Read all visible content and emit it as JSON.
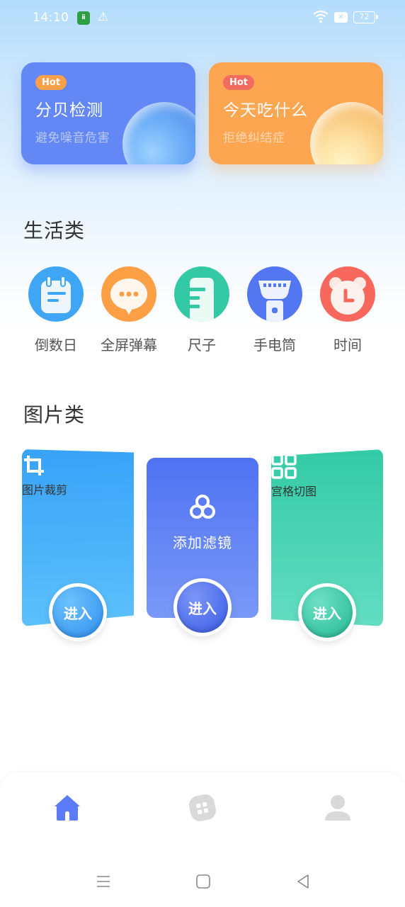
{
  "status_bar": {
    "time": "14:10",
    "battery": "72",
    "icons": [
      "app-notification-icon",
      "warning-icon",
      "wifi-icon",
      "sim-icon",
      "battery-icon"
    ]
  },
  "hot_cards": [
    {
      "badge": "Hot",
      "title": "分贝检测",
      "subtitle": "避免噪音危害",
      "color": "#6388f5"
    },
    {
      "badge": "Hot",
      "title": "今天吃什么",
      "subtitle": "拒绝纠结症",
      "color": "#fda651"
    }
  ],
  "sections": {
    "life": {
      "title": "生活类",
      "items": [
        {
          "label": "倒数日",
          "icon": "calendar-icon",
          "color": "#3ea6f4"
        },
        {
          "label": "全屏弹幕",
          "icon": "chat-bubble-icon",
          "color": "#fd9f45"
        },
        {
          "label": "尺子",
          "icon": "ruler-icon",
          "color": "#34c9a5"
        },
        {
          "label": "手电筒",
          "icon": "flashlight-icon",
          "color": "#5277f0"
        },
        {
          "label": "时间",
          "icon": "alarm-clock-icon",
          "color": "#f7675b"
        }
      ]
    },
    "image": {
      "title": "图片类",
      "items": [
        {
          "label": "图片裁剪",
          "icon": "crop-icon",
          "button": "进入",
          "color": "#42a8f8"
        },
        {
          "label": "添加滤镜",
          "icon": "filter-icon",
          "button": "进入",
          "color": "#5577ef"
        },
        {
          "label": "宫格切图",
          "icon": "grid-icon",
          "button": "进入",
          "color": "#3ccfaa"
        }
      ]
    }
  },
  "tab_bar": {
    "active_color": "#5b7cf6",
    "inactive_color": "#d9d9d9",
    "tabs": [
      {
        "name": "home",
        "icon": "home-icon",
        "active": true
      },
      {
        "name": "apps",
        "icon": "apps-icon",
        "active": false
      },
      {
        "name": "profile",
        "icon": "user-icon",
        "active": false
      }
    ]
  },
  "system_nav": [
    "menu-icon",
    "home-square-icon",
    "back-icon"
  ]
}
